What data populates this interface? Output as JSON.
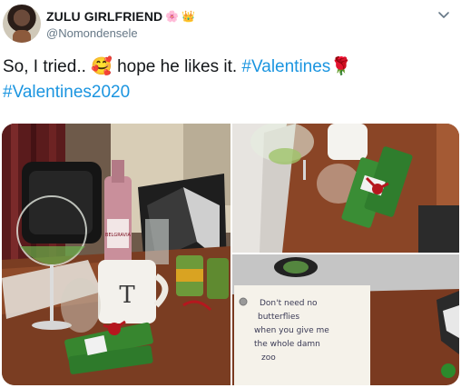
{
  "author": {
    "display_name": "ZULU GIRLFRIEND",
    "name_emojis": [
      "🌸",
      "👑"
    ],
    "handle": "@Nomondensele"
  },
  "tweet": {
    "text_main": "So, I tried.. ",
    "text_emoji": "🥰",
    "text_after": " hope he likes it. ",
    "hashtag_1": "#Valentines",
    "rose_emoji": "🌹",
    "hashtag_2": "#Valentines2020"
  },
  "media": {
    "photo_left": {
      "mug_letter": "T",
      "wine_label": "BELGRAVIA"
    },
    "photo_bottom_right": {
      "note_lines": [
        "Don't need no",
        "butterflies",
        "when you give me",
        "the whole damn",
        "zoo"
      ]
    }
  },
  "colors": {
    "hashtag": "#1b95e0",
    "handle": "#657786"
  },
  "icons": {
    "menu": "chevron-down-icon"
  }
}
